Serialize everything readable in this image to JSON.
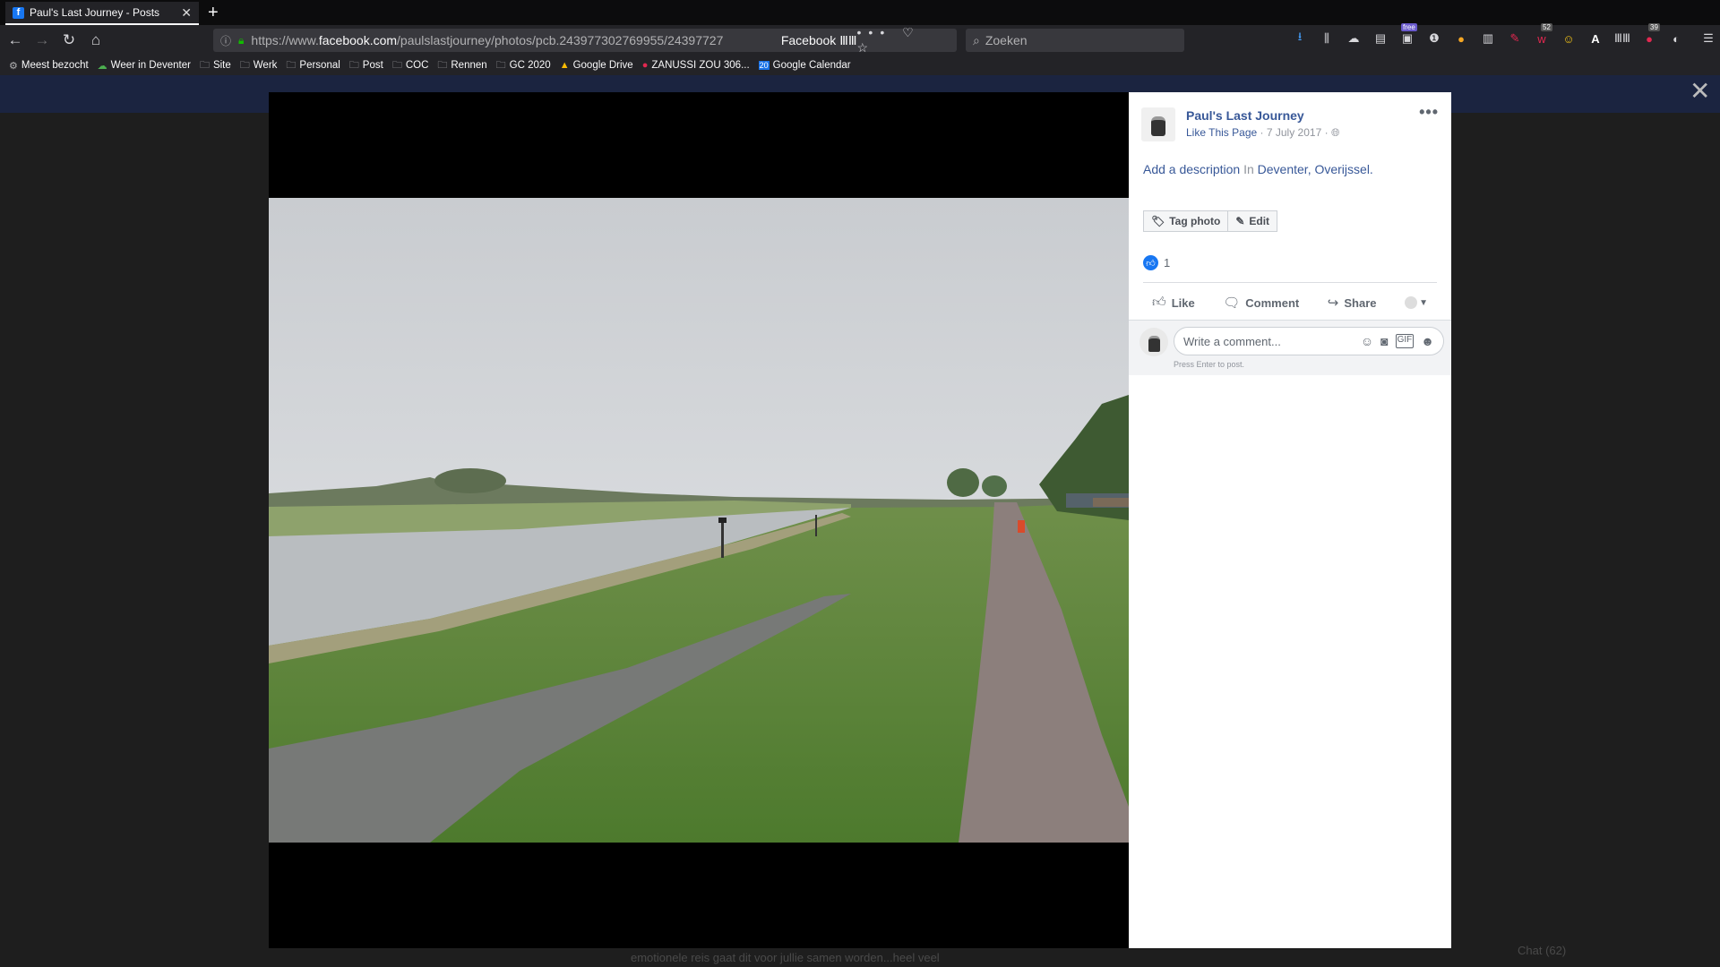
{
  "browser": {
    "tab_title": "Paul's Last Journey - Posts",
    "tab_favicon": "f",
    "url_prefix": "https://www.",
    "url_domain": "facebook.com",
    "url_rest": "/paulslastjourney/photos/pcb.243977302769955/24397727",
    "site_label": "Facebook ⅢⅢ",
    "search_placeholder": "Zoeken",
    "url_actions": "••• ♡ ☆"
  },
  "bookmarks": [
    {
      "label": "Meest bezocht",
      "icon": "gear-icon"
    },
    {
      "label": "Weer in Deventer",
      "icon": "weather-icon"
    },
    {
      "label": "Site",
      "icon": "folder-icon"
    },
    {
      "label": "Werk",
      "icon": "folder-icon"
    },
    {
      "label": "Personal",
      "icon": "folder-icon"
    },
    {
      "label": "Post",
      "icon": "folder-icon"
    },
    {
      "label": "COC",
      "icon": "folder-icon"
    },
    {
      "label": "Rennen",
      "icon": "folder-icon"
    },
    {
      "label": "GC 2020",
      "icon": "folder-icon"
    },
    {
      "label": "Google Drive",
      "icon": "drive-icon"
    },
    {
      "label": "ZANUSSI ZOU 306...",
      "icon": "zanussi-icon"
    },
    {
      "label": "Google Calendar",
      "icon": "calendar-icon"
    }
  ],
  "extension_badges": {
    "free": "free",
    "count_52": "52",
    "count_39": "39"
  },
  "post": {
    "page_name": "Paul's Last Journey",
    "like_page": "Like This Page",
    "date": "7 July 2017",
    "description_link": "Add a description",
    "in_word": "In",
    "location": "Deventer, Overijssel.",
    "tag_photo": "Tag photo",
    "edit": "Edit",
    "like_count": "1",
    "action_like": "Like",
    "action_comment": "Comment",
    "action_share": "Share",
    "comment_placeholder": "Write a comment...",
    "press_enter": "Press Enter to post."
  },
  "background": {
    "snippet": "emotionele reis gaat dit voor jullie samen worden...heel veel",
    "chat": "Chat (62)"
  },
  "colors": {
    "fb_link": "#385898",
    "fb_blue": "#1877f2",
    "grass": "#5e8a3a",
    "river": "#b8bcbf",
    "sky": "#d7d9dc"
  }
}
